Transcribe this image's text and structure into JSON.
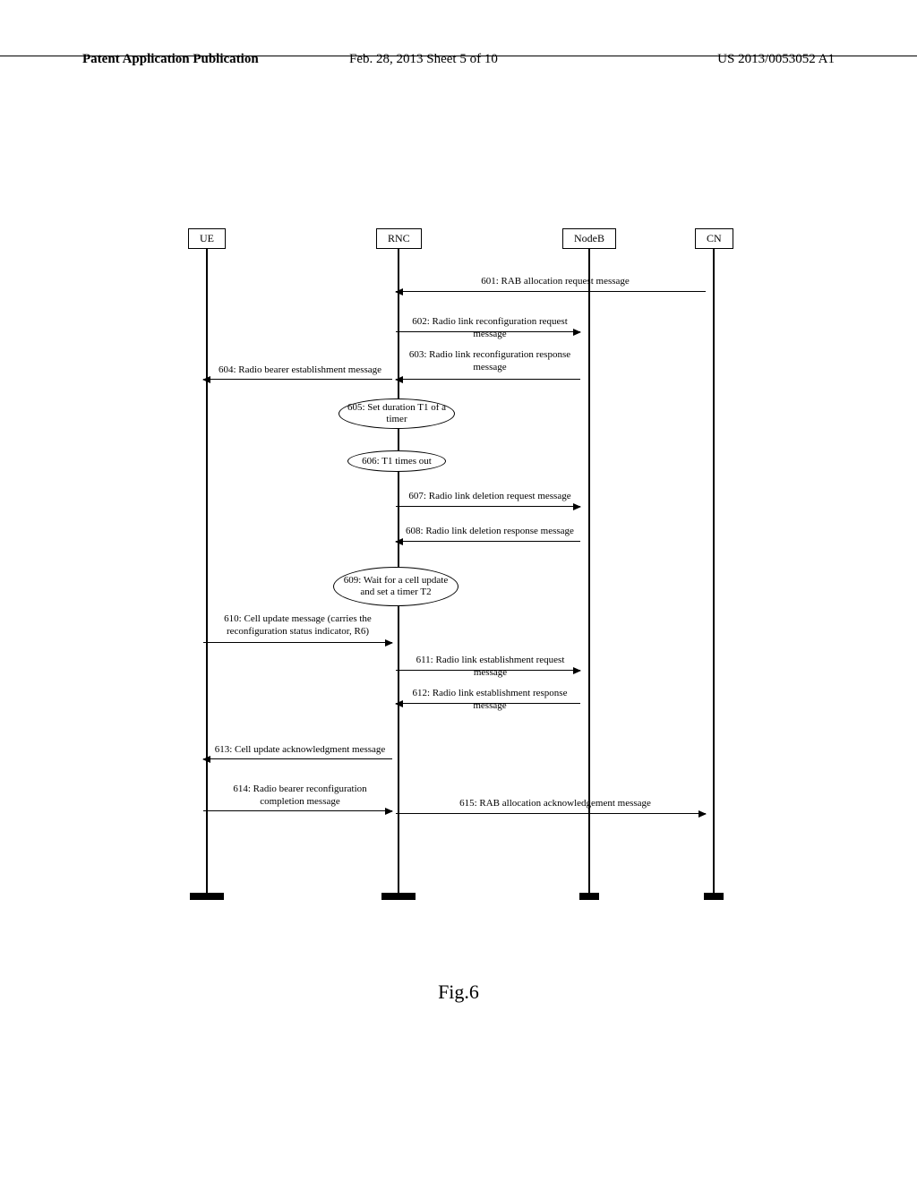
{
  "header": {
    "left": "Patent Application Publication",
    "mid": "Feb. 28, 2013  Sheet 5 of 10",
    "right": "US 2013/0053052 A1"
  },
  "actors": {
    "ue": "UE",
    "rnc": "RNC",
    "nodeb": "NodeB",
    "cn": "CN"
  },
  "messages": {
    "m601": "601: RAB allocation request message",
    "m602": "602: Radio link reconfiguration request message",
    "m603": "603: Radio link reconfiguration response message",
    "m604": "604: Radio bearer establishment message",
    "m605": "605: Set duration T1 of a timer",
    "m606": "606: T1 times out",
    "m607": "607: Radio link deletion request message",
    "m608": "608: Radio link deletion response message",
    "m609": "609: Wait for a cell update and set a timer T2",
    "m610": "610: Cell update message (carries the reconfiguration status indicator, R6)",
    "m611": "611: Radio link establishment request message",
    "m612": "612: Radio link establishment response message",
    "m613": "613: Cell update acknowledgment message",
    "m614": "614: Radio bearer reconfiguration completion message",
    "m615": "615: RAB allocation acknowledgement message"
  },
  "caption": "Fig.6",
  "chart_data": {
    "type": "sequence-diagram",
    "participants": [
      "UE",
      "RNC",
      "NodeB",
      "CN"
    ],
    "interactions": [
      {
        "id": "601",
        "from": "CN",
        "to": "RNC",
        "label": "RAB allocation request message"
      },
      {
        "id": "602",
        "from": "RNC",
        "to": "NodeB",
        "label": "Radio link reconfiguration request message"
      },
      {
        "id": "603",
        "from": "NodeB",
        "to": "RNC",
        "label": "Radio link reconfiguration response message"
      },
      {
        "id": "604",
        "from": "RNC",
        "to": "UE",
        "label": "Radio bearer establishment message"
      },
      {
        "id": "605",
        "at": "RNC",
        "kind": "note",
        "label": "Set duration T1 of a timer"
      },
      {
        "id": "606",
        "at": "RNC",
        "kind": "note",
        "label": "T1 times out"
      },
      {
        "id": "607",
        "from": "RNC",
        "to": "NodeB",
        "label": "Radio link deletion request message"
      },
      {
        "id": "608",
        "from": "NodeB",
        "to": "RNC",
        "label": "Radio link deletion response message"
      },
      {
        "id": "609",
        "at": "RNC",
        "kind": "note",
        "label": "Wait for a cell update and set a timer T2"
      },
      {
        "id": "610",
        "from": "UE",
        "to": "RNC",
        "label": "Cell update message (carries the reconfiguration status indicator, R6)"
      },
      {
        "id": "611",
        "from": "RNC",
        "to": "NodeB",
        "label": "Radio link establishment request message"
      },
      {
        "id": "612",
        "from": "NodeB",
        "to": "RNC",
        "label": "Radio link establishment response message"
      },
      {
        "id": "613",
        "from": "RNC",
        "to": "UE",
        "label": "Cell update acknowledgment message"
      },
      {
        "id": "614",
        "from": "UE",
        "to": "RNC",
        "label": "Radio bearer reconfiguration completion message"
      },
      {
        "id": "615",
        "from": "RNC",
        "to": "CN",
        "label": "RAB allocation acknowledgement message"
      }
    ]
  }
}
